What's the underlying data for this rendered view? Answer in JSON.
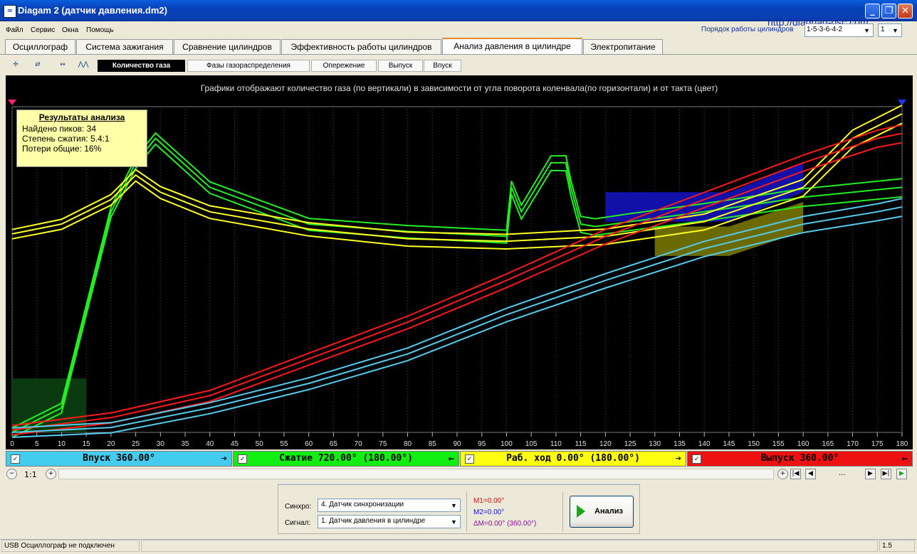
{
  "window": {
    "title": "Diagam 2 (датчик давления.dm2)",
    "minimize": "_",
    "restore": "❐",
    "close": "✕"
  },
  "menu": [
    "Файл",
    "Сервис",
    "Окна",
    "Помощь"
  ],
  "header": {
    "url": "http://diagnag-osc.com",
    "cylinder_order_label": "Порядок работы цилиндров",
    "cylinder_order_value": "1-5-3-6-4-2",
    "cylinder_value": "1"
  },
  "tabs": [
    {
      "label": "Осциллограф"
    },
    {
      "label": "Система зажигания"
    },
    {
      "label": "Сравнение цилиндров"
    },
    {
      "label": "Эффективность работы цилиндров"
    },
    {
      "label": "Анализ давления в цилиндре",
      "active": true
    },
    {
      "label": "Электропитание"
    }
  ],
  "toolbar_icons": [
    "crosshair-icon",
    "1234-icon",
    "auto-icon",
    "peaks-icon"
  ],
  "subtabs": [
    {
      "label": "Количество газа",
      "active": true
    },
    {
      "label": "Фазы газораспределения"
    },
    {
      "label": "Опережение"
    },
    {
      "label": "Выпуск"
    },
    {
      "label": "Впуск"
    }
  ],
  "chart": {
    "title": "Графики отображают количество газа (по вертикали) в зависимости от угла поворота коленвала(по горизонтали) и от такта (цвет)"
  },
  "results": {
    "title": "Результаты анализа",
    "peaks": "Найдено пиков: 34",
    "compression": "Степень сжатия: 5.4:1",
    "losses": "Потери общие: 16%"
  },
  "chart_data": {
    "type": "line",
    "xlabel": "",
    "ylabel": "",
    "xlim": [
      0,
      180
    ],
    "x_ticks": [
      0,
      5,
      10,
      15,
      20,
      25,
      30,
      35,
      40,
      45,
      50,
      55,
      60,
      65,
      70,
      75,
      80,
      85,
      90,
      95,
      100,
      105,
      110,
      115,
      120,
      125,
      130,
      135,
      140,
      145,
      150,
      155,
      160,
      165,
      170,
      175,
      180
    ],
    "colors": {
      "green": "#22ee22",
      "yellow": "#ffff22",
      "red": "#ff1a1a",
      "cyan": "#55ccee"
    },
    "series": [
      {
        "color": "green",
        "x": [
          0,
          10,
          20,
          25,
          29,
          40,
          60,
          80,
          100,
          101,
          103,
          106,
          109,
          112,
          113,
          115,
          118,
          125,
          140,
          160,
          180
        ],
        "y": [
          0.0,
          0.1,
          0.9,
          1.1,
          1.2,
          1.0,
          0.85,
          0.82,
          0.8,
          1.0,
          0.9,
          1.0,
          1.1,
          1.1,
          1.0,
          0.85,
          0.84,
          0.86,
          0.9,
          0.96,
          1.0
        ]
      },
      {
        "color": "yellow",
        "x": [
          0,
          10,
          20,
          25,
          30,
          40,
          60,
          80,
          100,
          120,
          140,
          160,
          170,
          180
        ],
        "y": [
          0.81,
          0.85,
          0.95,
          1.05,
          0.98,
          0.9,
          0.83,
          0.79,
          0.78,
          0.8,
          0.86,
          1.0,
          1.2,
          1.3
        ]
      },
      {
        "color": "red",
        "x": [
          0,
          20,
          40,
          60,
          80,
          100,
          120,
          140,
          160,
          175,
          180
        ],
        "y": [
          0.01,
          0.06,
          0.15,
          0.3,
          0.45,
          0.62,
          0.8,
          0.95,
          1.1,
          1.2,
          1.22
        ]
      },
      {
        "color": "cyan",
        "x": [
          0,
          20,
          40,
          60,
          80,
          100,
          120,
          140,
          160,
          175,
          180
        ],
        "y": [
          0.0,
          0.02,
          0.1,
          0.2,
          0.32,
          0.48,
          0.62,
          0.75,
          0.85,
          0.9,
          0.92
        ]
      }
    ]
  },
  "phases": [
    {
      "label": "Впуск 360.00°",
      "color": "#44ccee",
      "check": "✓",
      "arrow": "➔"
    },
    {
      "label": "Сжатие 720.00° (180.00°)",
      "color": "#11ee11",
      "check": "✓",
      "arrow": "←"
    },
    {
      "label": "Раб. ход 0.00° (180.00°)",
      "color": "#ffff11",
      "check": "✓",
      "arrow": "➔"
    },
    {
      "label": "Выпуск 360.00°",
      "color": "#ee1111",
      "check": "✓",
      "arrow": "←"
    }
  ],
  "scroll": {
    "zoom_label": "1:1",
    "zoom_out": "−",
    "zoom_in": "+",
    "dots": "...",
    "first": "|◀",
    "prev": "◀",
    "next": "▶",
    "last": "▶|",
    "play": "▶"
  },
  "controls": {
    "sync_label": "Синхро:",
    "sync_value": "4. Датчик синхронизации",
    "signal_label": "Сигнал:",
    "signal_value": "1. Датчик давления в цилиндре",
    "m1": "M1=0.00°",
    "m2": "M2=0.00°",
    "dm": "ΔM=0.00° (360.00°)",
    "m1_color": "#cc1111",
    "m2_color": "#1111cc",
    "dm_color": "#881199",
    "analyze_label": "Анализ"
  },
  "status": {
    "usb": "USB Осциллограф не подключен",
    "version": "1.5"
  }
}
